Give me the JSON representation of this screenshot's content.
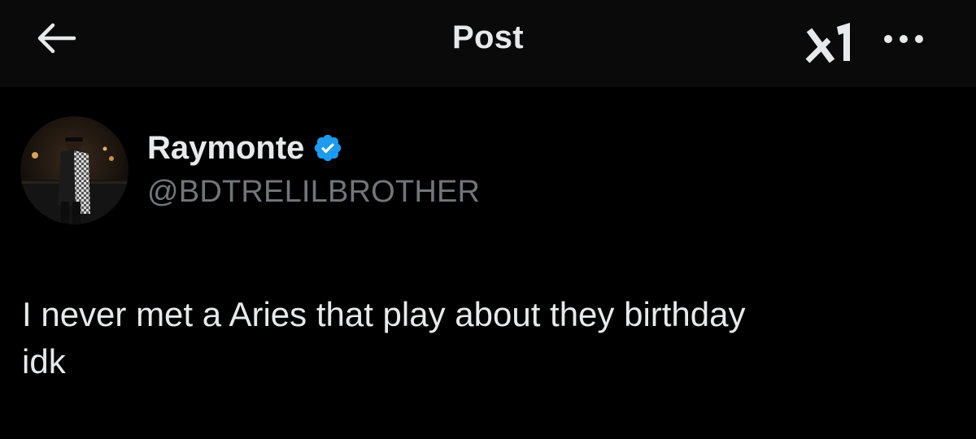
{
  "header": {
    "title": "Post",
    "back_icon": "arrow-left-icon",
    "grok_icon": "grok-icon",
    "more_icon": "more-horizontal-icon"
  },
  "author": {
    "display_name": "Raymonte",
    "handle": "@BDTRELILBROTHER",
    "verified": true,
    "verified_icon": "verified-badge-icon",
    "verified_color": "#1d9bf0"
  },
  "post": {
    "text": "I never met a Aries that play about they birthday\nidk"
  },
  "colors": {
    "background": "#000000",
    "topbar": "#0a0a0a",
    "primary_text": "#e7e9ea",
    "secondary_text": "#71767b"
  }
}
